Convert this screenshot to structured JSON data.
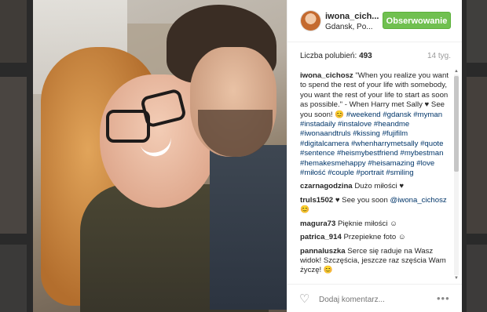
{
  "post": {
    "username": "iwona_cich...",
    "location": "Gdansk, Po...",
    "follow_label": "Obserwowanie",
    "likes_label": "Liczba polubień:",
    "likes_count": "493",
    "age": "14 tyg.",
    "add_comment_placeholder": "Dodaj komentarz...",
    "more_label": "•••"
  },
  "caption": {
    "user": "iwona_cichosz",
    "text": "\"When you realize you want to spend the rest of your life with somebody, you want the rest of your life to start as soon as possible.\" - When Harry met Sally ♥ See you soon! 😊",
    "tags": [
      "#weekend",
      "#gdansk",
      "#myman",
      "#instadaily",
      "#instalove",
      "#heandme",
      "#iwonaandtruls",
      "#kissing",
      "#fujifilm",
      "#digitalcamera",
      "#whenharrymetsally",
      "#quote",
      "#sentence",
      "#heismybestfriend",
      "#mybestman",
      "#hemakesmehappy",
      "#heisamazing",
      "#love",
      "#miłość",
      "#couple",
      "#portrait",
      "#smiling"
    ]
  },
  "comments": [
    {
      "user": "czarnagodzina",
      "text": "Dużo miłości ♥"
    },
    {
      "user": "truls1502",
      "text": "♥ See you soon",
      "mention": "@iwona_cichosz",
      "tail": "😊"
    },
    {
      "user": "magura73",
      "text": "Pięknie miłości ☺"
    },
    {
      "user": "patrica_914",
      "text": "Przepiekne foto ☺"
    },
    {
      "user": "pannaluszka",
      "text": "Serce się raduje na Wasz widok! Szczęścia, jeszcze raz szęścia Wam życzę! 😊"
    }
  ],
  "icons": {
    "heart": "heart-icon",
    "more": "more-options-icon",
    "scroll_up": "scroll-up-icon",
    "scroll_down": "scroll-down-icon"
  },
  "colors": {
    "follow_button": "#70c050",
    "hashtag": "#003569",
    "text": "#262626",
    "muted": "#999999"
  }
}
